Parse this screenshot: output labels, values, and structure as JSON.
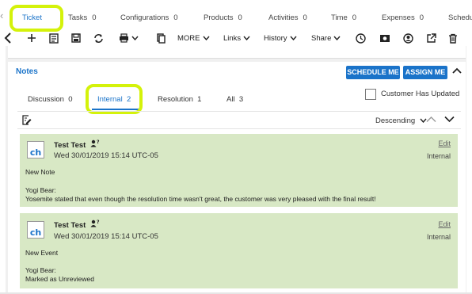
{
  "tabs": [
    {
      "label": "Ticket",
      "count": ""
    },
    {
      "label": "Tasks",
      "count": "0"
    },
    {
      "label": "Configurations",
      "count": "0"
    },
    {
      "label": "Products",
      "count": "0"
    },
    {
      "label": "Activities",
      "count": "0"
    },
    {
      "label": "Time",
      "count": "0"
    },
    {
      "label": "Expenses",
      "count": "0"
    },
    {
      "label": "Schedu",
      "count": ""
    }
  ],
  "toolbar": {
    "more_label": "MORE",
    "links_label": "Links",
    "history_label": "History",
    "share_label": "Share"
  },
  "notes": {
    "title": "Notes",
    "schedule_label": "SCHEDULE ME",
    "assign_label": "ASSIGN ME",
    "subtabs": [
      {
        "label": "Discussion",
        "count": "0"
      },
      {
        "label": "Internal",
        "count": "2"
      },
      {
        "label": "Resolution",
        "count": "1"
      },
      {
        "label": "All",
        "count": "3"
      }
    ],
    "customer_updated_label": "Customer Has Updated",
    "customer_updated_checked": false,
    "sort_label": "Descending",
    "items": [
      {
        "author": "Test Test",
        "date": "Wed 30/01/2019 15:14 UTC-05",
        "edit": "Edit",
        "visibility": "Internal",
        "type": "New Note",
        "who": "Yogi Bear:",
        "text": "Yosemite stated that even though the resolution time wasn't great, the customer was very pleased with the final result!"
      },
      {
        "author": "Test Test",
        "date": "Wed 30/01/2019 15:14 UTC-05",
        "edit": "Edit",
        "visibility": "Internal",
        "type": "New Event",
        "who": "Yogi Bear:",
        "text": "Marked as Unreviewed"
      }
    ],
    "logo_text": "ch"
  },
  "colors": {
    "accent": "#1a73c9",
    "highlight": "#d4f20a",
    "note_bg": "#d8e8c5"
  }
}
